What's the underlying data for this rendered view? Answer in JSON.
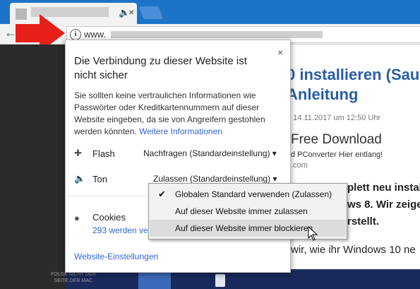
{
  "browser": {
    "tab": {
      "audio_icon": "speaker-icon",
      "close_glyph": "×"
    },
    "toolbar": {
      "back_glyph": "←"
    },
    "omnibox": {
      "info_glyph": "i",
      "url_prefix": "www."
    }
  },
  "article": {
    "heading_line1": "0 installieren (Sau",
    "heading_line2": "Anleitung",
    "date": "n 14.11.2017 um 12:50 Uhr",
    "ad_title": "Free Download",
    "ad_sub": "d PConverter Hier entlang!",
    "ad_domain": ".com",
    "body1": "plett neu instal",
    "body2": "ws 8. Wir zeige",
    "body3": "rstellt.",
    "body4": "wir, wie ihr Windows 10 ne"
  },
  "bottom_text": "FOLGE NICHT DER\nSEITE DER MAC",
  "popup": {
    "title": "Die Verbindung zu dieser Website ist nicht sicher",
    "description": "Sie sollten keine vertraulichen Informationen wie Passwörter oder Kreditkartennummern auf dieser Website eingeben, da sie von Angreifern gestohlen werden könnten.",
    "more_info_link": "Weitere Informationen",
    "close_glyph": "×",
    "permissions": [
      {
        "icon": "puzzle-icon",
        "label": "Flash",
        "value": "Nachfragen (Standardeinstellung)"
      },
      {
        "icon": "speaker-icon",
        "label": "Ton",
        "value": "Zulassen (Standardeinstellung)"
      }
    ],
    "cookies": {
      "label": "Cookies",
      "count_text": "293 werden ve"
    },
    "site_settings_link": "Website-Einstellungen"
  },
  "dropdown": {
    "options": [
      {
        "label": "Globalen Standard verwenden (Zulassen)",
        "checked": true
      },
      {
        "label": "Auf dieser Website immer zulassen",
        "checked": false
      },
      {
        "label": "Auf dieser Website immer blockieren",
        "checked": false,
        "hovered": true
      }
    ],
    "check_glyph": "✔"
  },
  "colors": {
    "arrow": "#e8201a",
    "link": "#3367d6",
    "tabstrip": "#1b74c8"
  }
}
